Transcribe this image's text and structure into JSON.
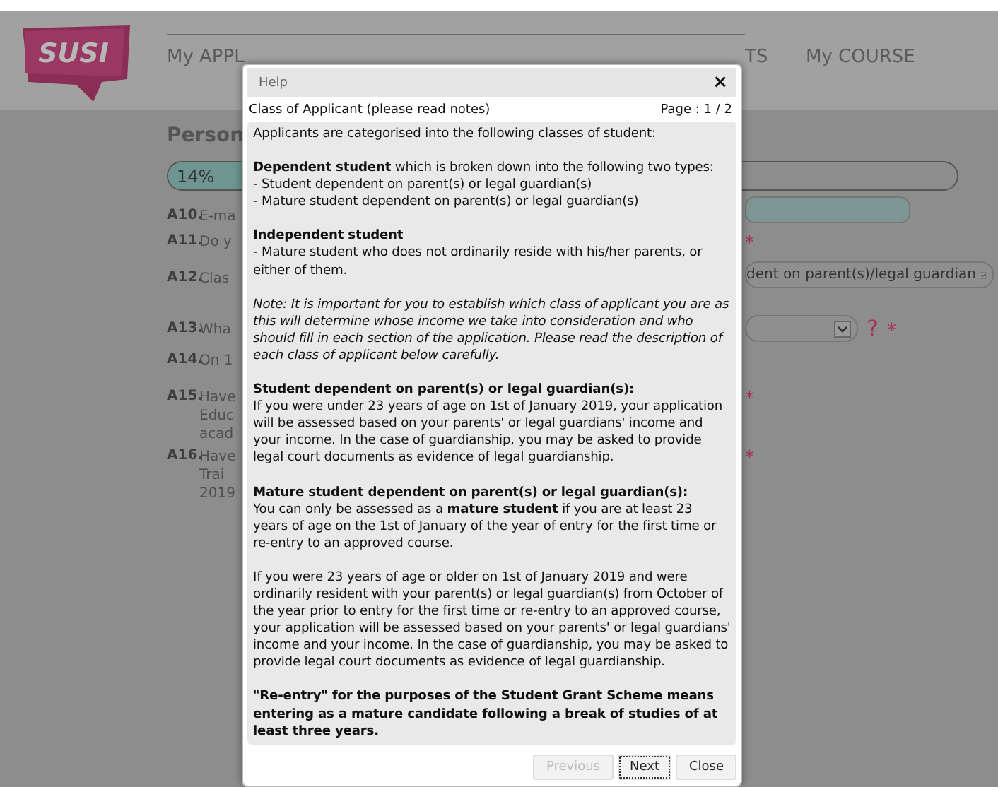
{
  "logo": {
    "text": "SUSI"
  },
  "nav": [
    {
      "label": "My APPL",
      "selected": true
    },
    {
      "label": "TS",
      "selected": false
    },
    {
      "label": "My COURSE",
      "selected": false
    }
  ],
  "section_title": "Person",
  "progress": {
    "label": "14%",
    "level": 0.14
  },
  "form_rows": [
    {
      "number": "A10.",
      "lines": [
        "E-ma"
      ],
      "control": {
        "kind": "email"
      },
      "required": false
    },
    {
      "number": "A11.",
      "lines": [
        "Do y"
      ],
      "required": true
    },
    {
      "number": "A12.",
      "lines": [
        "Clas"
      ],
      "control": {
        "kind": "select",
        "value": "dent on parent(s)/legal guardian"
      },
      "required": false
    },
    {
      "number": "A13.",
      "lines": [
        "Wha"
      ],
      "control": {
        "kind": "select-help",
        "help": "?",
        "mark": "*"
      },
      "required": false
    },
    {
      "number": "A14.",
      "lines": [
        "On 1"
      ],
      "required": false
    },
    {
      "number": "A15.",
      "lines": [
        "Have",
        "Educ",
        "acad"
      ],
      "required": true
    },
    {
      "number": "A16.",
      "lines": [
        "Have",
        "Trai",
        "2019"
      ],
      "required": true
    }
  ],
  "required_mark": "*",
  "dialog": {
    "title": "Help",
    "close": "×",
    "subtitle": "Class of Applicant (please read notes)",
    "page": "Page : 1 / 2",
    "blocks": [
      [
        {
          "kind": "text",
          "text": "Applicants are categorised into the following classes of student:"
        }
      ],
      [
        {
          "kind": "text",
          "text": "**Dependent student** which is broken down into the following two types:"
        },
        {
          "kind": "text",
          "text": "- Student dependent on parent(s) or legal guardian(s)"
        },
        {
          "kind": "text",
          "text": "- Mature student dependent on parent(s) or legal guardian(s)"
        }
      ],
      [
        {
          "kind": "heading",
          "text": "Independent student"
        },
        {
          "kind": "text",
          "text": "- Mature student who does not ordinarily reside with his/her parents, or either of them."
        }
      ],
      [
        {
          "kind": "note",
          "text": "Note: It is important for you to establish which class of applicant you are as this will determine whose income we take into consideration and who should fill in each section of the application. Please read the description of each class of applicant below carefully."
        }
      ],
      [
        {
          "kind": "heading",
          "text": "Student dependent on parent(s) or legal guardian(s):"
        },
        {
          "kind": "text",
          "text": "If you were under 23 years of age on 1st of January 2019, your application will be assessed based on your parents' or legal guardians' income and your income. In the case of guardianship, you may be asked to provide legal court documents as evidence of legal guardianship."
        }
      ],
      [
        {
          "kind": "heading",
          "text": "Mature student dependent on parent(s) or legal guardian(s):"
        },
        {
          "kind": "text",
          "text": "You can only be assessed as a **mature student** if you are at least 23 years of age on the 1st of January of the year of entry for the first time or re-entry to an approved course."
        }
      ],
      [
        {
          "kind": "text",
          "text": "If you were 23 years of age or older on 1st of January 2019 and were ordinarily resident with your parent(s) or legal guardian(s) from October of the year prior to entry for the first time or re-entry to an approved course, your application will be assessed based on your parents' or legal guardians' income and your income. In the case of guardianship, you may be asked to provide legal court documents as evidence of legal guardianship."
        }
      ],
      [
        {
          "kind": "heading",
          "text": "\"Re-entry\" for the purposes of the Student Grant Scheme means entering as a mature candidate following a break of studies of at least three years."
        }
      ]
    ],
    "buttons": [
      {
        "label": "Previous",
        "disabled": true,
        "focused": false
      },
      {
        "label": "Next",
        "disabled": false,
        "focused": true
      },
      {
        "label": "Close",
        "disabled": false,
        "focused": false
      }
    ]
  }
}
